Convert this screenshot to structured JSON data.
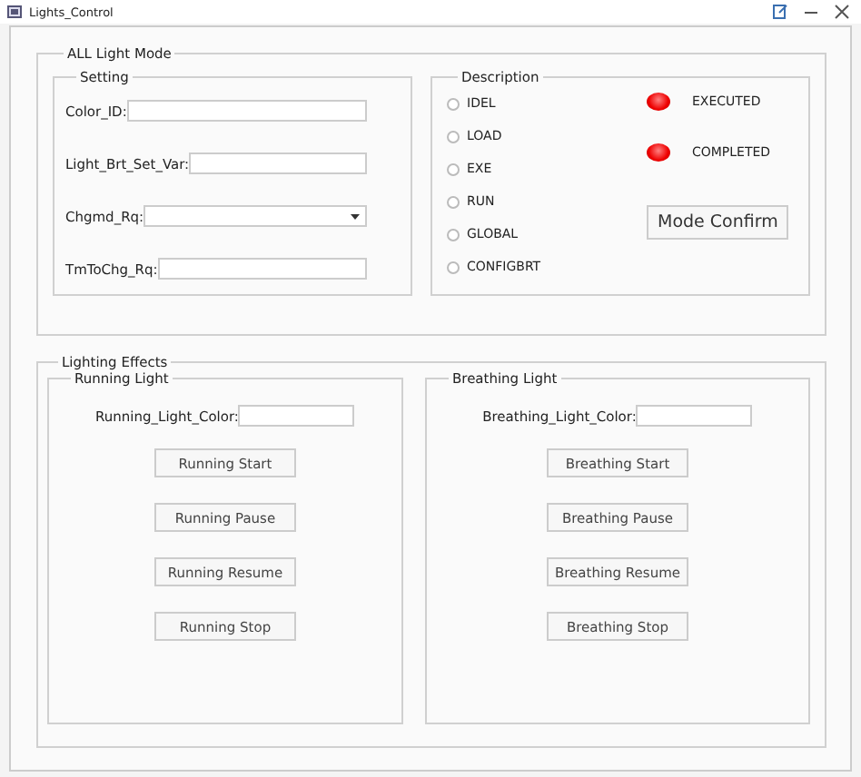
{
  "window": {
    "title": "Lights_Control"
  },
  "mode_group": {
    "title": "ALL Light Mode",
    "setting": {
      "title": "Setting",
      "fields": [
        {
          "label": "Color_ID:",
          "kind": "text"
        },
        {
          "label": "Light_Brt_Set_Var:",
          "kind": "text"
        },
        {
          "label": "Chgmd_Rq:",
          "kind": "dropdown"
        },
        {
          "label": "TmToChg_Rq:",
          "kind": "text"
        }
      ]
    },
    "description": {
      "title": "Description",
      "modes": [
        {
          "label": "IDEL",
          "selected": false
        },
        {
          "label": "LOAD",
          "selected": false
        },
        {
          "label": "EXE",
          "selected": false
        },
        {
          "label": "RUN",
          "selected": false
        },
        {
          "label": "GLOBAL",
          "selected": false
        },
        {
          "label": "CONFIGBRT",
          "selected": false
        }
      ],
      "indicators": [
        {
          "label": "EXECUTED",
          "on": true
        },
        {
          "label": "COMPLETED",
          "on": true
        }
      ],
      "confirm_button": "Mode Confirm"
    }
  },
  "effects_group": {
    "title": "Lighting Effects",
    "panels": [
      {
        "title": "Running Light",
        "color_label": "Running_Light_Color:",
        "buttons": [
          "Running Start",
          "Running Pause",
          "Running Resume",
          "Running Stop"
        ]
      },
      {
        "title": "Breathing Light",
        "color_label": "Breathing_Light_Color:",
        "buttons": [
          "Breathing Start",
          "Breathing Pause",
          "Breathing Resume",
          "Breathing Stop"
        ]
      }
    ]
  }
}
